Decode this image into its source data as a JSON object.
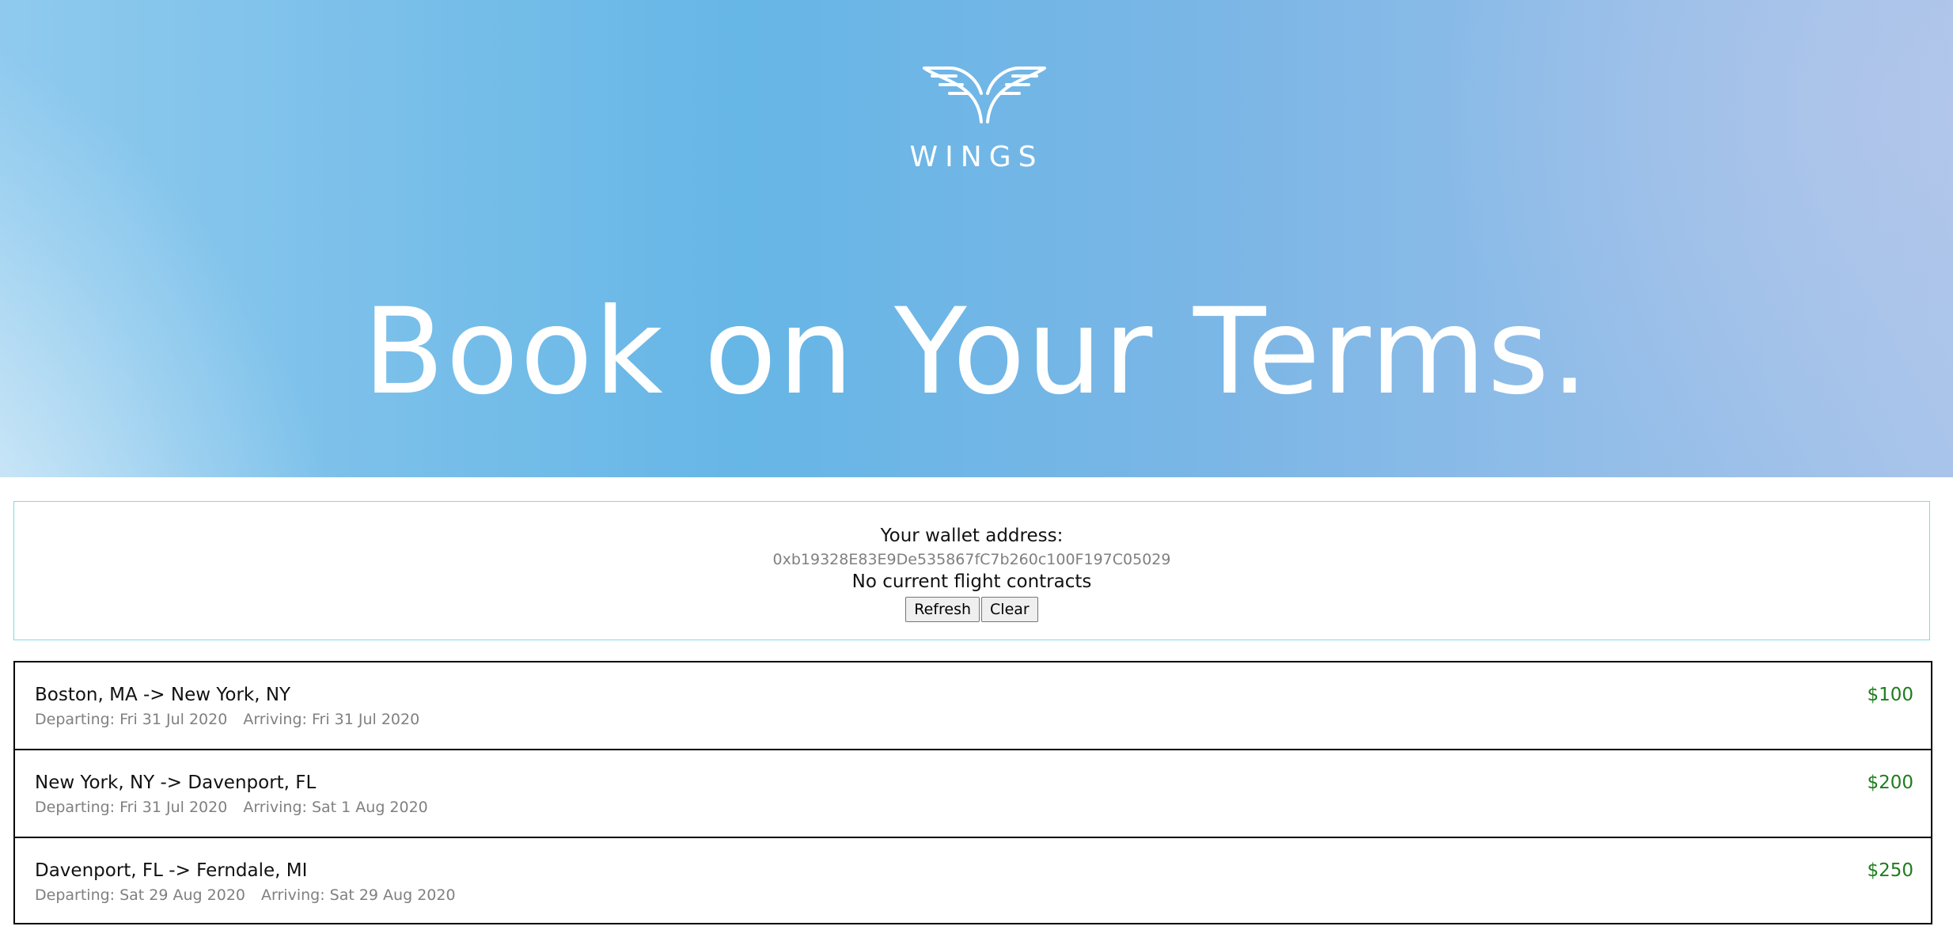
{
  "hero": {
    "brand_name": "WINGS",
    "headline": "Book on Your Terms.",
    "logo_icon": "wings-logo-icon"
  },
  "wallet": {
    "title": "Your wallet address:",
    "address": "0xb19328E83E9De535867fC7b260c100F197C05029",
    "contracts_status": "No current flight contracts",
    "refresh_label": "Refresh",
    "clear_label": "Clear"
  },
  "flights": [
    {
      "route": "Boston, MA -> New York, NY",
      "departing": "Departing: Fri 31 Jul 2020",
      "arriving": "Arriving: Fri 31 Jul 2020",
      "price": "$100"
    },
    {
      "route": "New York, NY -> Davenport, FL",
      "departing": "Departing: Fri 31 Jul 2020",
      "arriving": "Arriving: Sat 1 Aug 2020",
      "price": "$200"
    },
    {
      "route": "Davenport, FL -> Ferndale, MI",
      "departing": "Departing: Sat 29 Aug 2020",
      "arriving": "Arriving: Sat 29 Aug 2020",
      "price": "$250"
    }
  ],
  "colors": {
    "price": "#1e7d1e",
    "wallet_border": "#7fdcdc",
    "hero_blue": "#66b6e6"
  }
}
